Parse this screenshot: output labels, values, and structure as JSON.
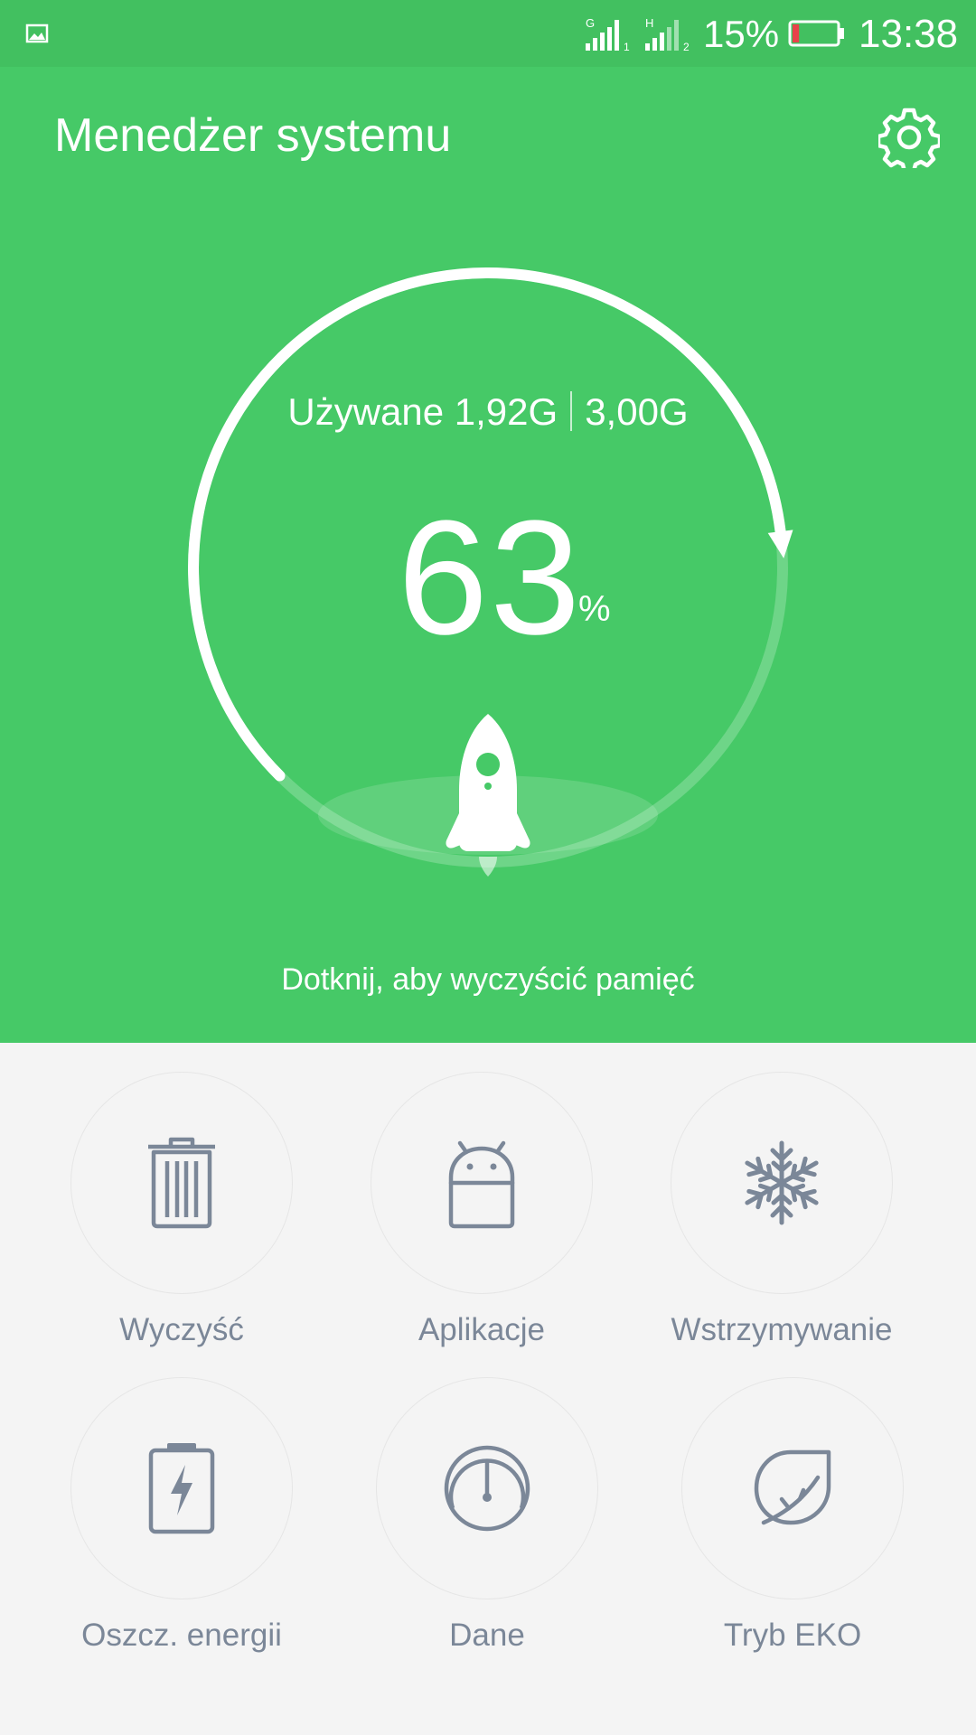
{
  "status_bar": {
    "signal1_tag": "G",
    "signal1_sim": "1",
    "signal2_tag": "H",
    "signal2_sim": "2",
    "battery_percent": "15%",
    "battery_level": 0.15,
    "time": "13:38"
  },
  "header": {
    "title": "Menedżer systemu",
    "settings_icon": "gear-icon"
  },
  "memory": {
    "used_label": "Używane 1,92G",
    "total_label": "3,00G",
    "percent_value": "63",
    "percent_sign": "%",
    "usage_fraction": 0.63,
    "tap_hint": "Dotknij, aby wyczyścić pamięć",
    "illustration_icon": "rocket-icon"
  },
  "colors": {
    "accent_green": "#46c967",
    "status_green": "#42c060",
    "icon_gray": "#7b8798",
    "background": "#f4f4f4"
  },
  "tools": [
    {
      "label": "Wyczyść",
      "icon": "trash-icon"
    },
    {
      "label": "Aplikacje",
      "icon": "android-icon"
    },
    {
      "label": "Wstrzymywanie",
      "icon": "snowflake-icon"
    },
    {
      "label": "Oszcz. energii",
      "icon": "battery-bolt-icon"
    },
    {
      "label": "Dane",
      "icon": "gauge-icon"
    },
    {
      "label": "Tryb EKO",
      "icon": "leaf-icon"
    }
  ]
}
